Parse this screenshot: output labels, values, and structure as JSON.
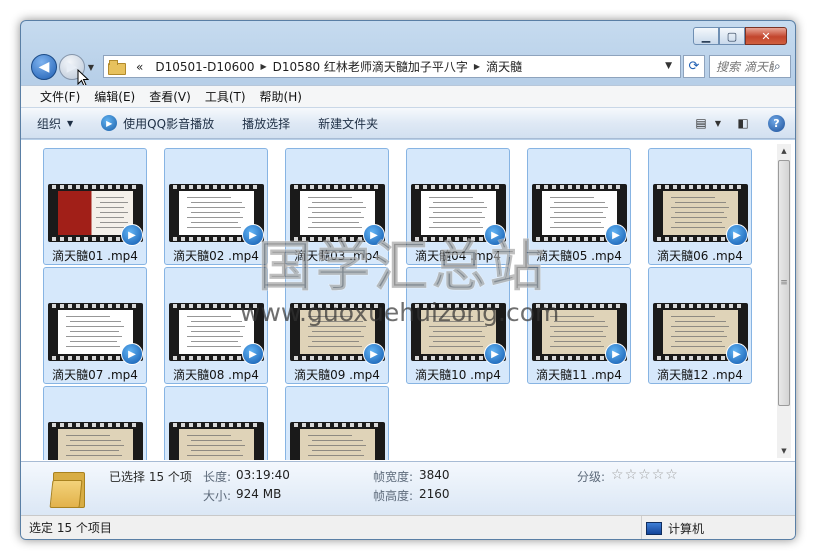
{
  "nav": {
    "breadcrumbs": [
      "D10501-D10600",
      "D10580 红林老师滴天髓加子平八字",
      "滴天髓"
    ],
    "overflow": "«",
    "search_placeholder": "搜索 滴天髓"
  },
  "menu": [
    "文件(F)",
    "编辑(E)",
    "查看(V)",
    "工具(T)",
    "帮助(H)"
  ],
  "toolbar": {
    "organize": "组织",
    "play_qq": "使用QQ影音播放",
    "play_selection": "播放选择",
    "new_folder": "新建文件夹"
  },
  "files": [
    {
      "name": "滴天髓01 .mp4",
      "thumb": "red"
    },
    {
      "name": "滴天髓02 .mp4",
      "thumb": "white"
    },
    {
      "name": "滴天髓03 .mp4",
      "thumb": "white"
    },
    {
      "name": "滴天髓04 .mp4",
      "thumb": "white"
    },
    {
      "name": "滴天髓05 .mp4",
      "thumb": "white"
    },
    {
      "name": "滴天髓06 .mp4",
      "thumb": "parchment"
    },
    {
      "name": "滴天髓07 .mp4",
      "thumb": "white"
    },
    {
      "name": "滴天髓08 .mp4",
      "thumb": "white"
    },
    {
      "name": "滴天髓09 .mp4",
      "thumb": "parchment"
    },
    {
      "name": "滴天髓10 .mp4",
      "thumb": "parchment"
    },
    {
      "name": "滴天髓11 .mp4",
      "thumb": "parchment"
    },
    {
      "name": "滴天髓12 .mp4",
      "thumb": "parchment"
    },
    {
      "name": "",
      "thumb": "parchment"
    },
    {
      "name": "",
      "thumb": "parchment"
    },
    {
      "name": "",
      "thumb": "parchment"
    }
  ],
  "details": {
    "selected": "已选择 15 个项",
    "length_label": "长度:",
    "length_value": "03:19:40",
    "size_label": "大小:",
    "size_value": "924 MB",
    "width_label": "帧宽度:",
    "width_value": "3840",
    "height_label": "帧高度:",
    "height_value": "2160",
    "rating_label": "分级:",
    "rating_value": 0
  },
  "status": {
    "left": "选定 15 个项目",
    "right": "计算机"
  },
  "watermark": {
    "cn": "国学汇总站",
    "url": "www.guoxuehuizong.com"
  }
}
